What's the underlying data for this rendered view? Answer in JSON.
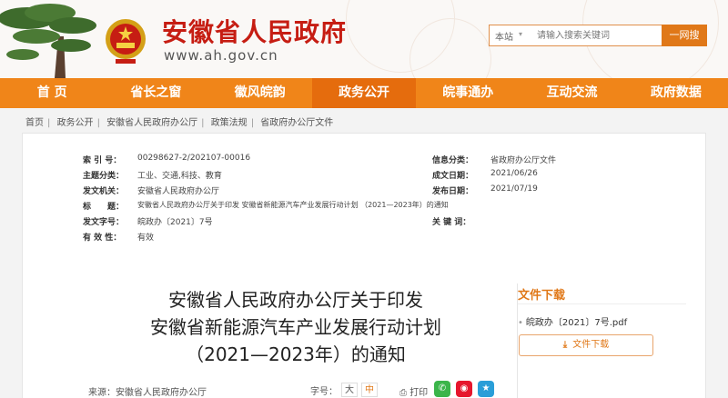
{
  "header": {
    "site_title": "安徽省人民政府",
    "site_url": "www.ah.gov.cn",
    "search": {
      "scope": "本站",
      "placeholder": "请输入搜索关键词",
      "button_label": "一网搜"
    }
  },
  "nav": {
    "items": [
      {
        "label": "首 页"
      },
      {
        "label": "省长之窗"
      },
      {
        "label": "徽风皖韵"
      },
      {
        "label": "政务公开",
        "active": true
      },
      {
        "label": "皖事通办"
      },
      {
        "label": "互动交流"
      },
      {
        "label": "政府数据"
      }
    ]
  },
  "breadcrumb": [
    "首页",
    "政务公开",
    "安徽省人民政府办公厅",
    "政策法规",
    "省政府办公厅文件"
  ],
  "meta": {
    "index_no_label": "索 引 号：",
    "index_no": "00298627-2/202107-00016",
    "info_source_label": "信息分类：",
    "info_source": "省政府办公厅文件",
    "topic_label": "主题分类：",
    "topic": "工业、交通,科技、教育",
    "created_label": "成文日期：",
    "created": "2021/06/26",
    "issuer_label": "发文机关：",
    "issuer": "安徽省人民政府办公厅",
    "published_label": "发布日期：",
    "published": "2021/07/19",
    "title_label": "标　　题：",
    "title": "安徽省人民政府办公厅关于印发 安徽省新能源汽车产业发展行动计划 （2021—2023年）的通知",
    "doc_no_label": "发文字号：",
    "doc_no": "皖政办〔2021〕7号",
    "keywords_label": "关 键 词：",
    "keywords": "",
    "validity_label": "有 效 性：",
    "validity": "有效"
  },
  "doc_title": {
    "line1": "安徽省人民政府办公厅关于印发",
    "line2": "安徽省新能源汽车产业发展行动计划",
    "line3": "（2021—2023年）的通知"
  },
  "download": {
    "title": "文件下载",
    "file_name": "皖政办〔2021〕7号.pdf",
    "button_label": "文件下载"
  },
  "footer": {
    "source": "来源：安徽省人民政府办公厅",
    "font_size_label": "字号：",
    "font_large": "大",
    "font_medium": "中",
    "print_label": "打印"
  },
  "colors": {
    "brand_red": "#c61d13",
    "nav_orange": "#f08519",
    "accent_orange": "#e07818"
  },
  "icons": [
    "pine-tree-icon",
    "national-emblem-icon",
    "chevron-down-icon",
    "download-icon",
    "print-icon",
    "wechat-icon",
    "weibo-icon",
    "qq-icon"
  ]
}
